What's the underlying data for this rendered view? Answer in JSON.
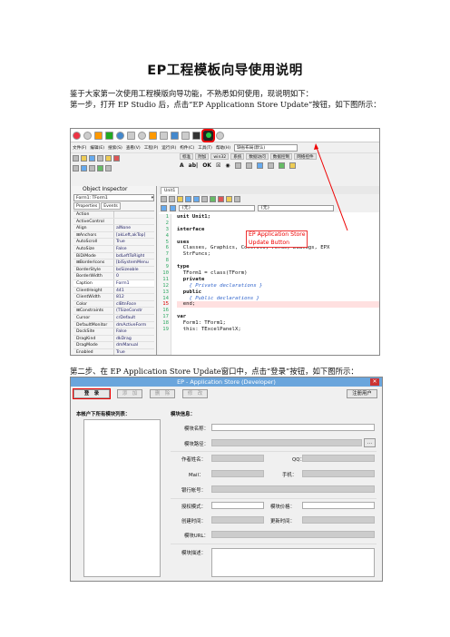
{
  "title": "EP工程模板向导使用说明",
  "intro": "鉴于大家第一次使用工程模版向导功能，不熟悉如何使用，现说明如下：",
  "step1": "第一步，打开 EP Studio 后，点击“EP Applicationn Store Update”按钮，如下图所示：",
  "step2": "第二步、在 EP Application Store Update窗口中，点击“登录”按钮，如下图所示：",
  "ide": {
    "menu": [
      "文件(F)",
      "编辑(E)",
      "搜索(S)",
      "查看(V)",
      "工程(P)",
      "运行(R)",
      "构件(C)",
      "工具(T)",
      "帮助(H)"
    ],
    "layout_combo": "缺省布局(默认)",
    "palette_tabs": [
      "标准",
      "附加",
      "win32",
      "系统",
      "数据访问",
      "数据控制",
      "网络控件"
    ],
    "palette_glyphs": [
      "A",
      "ab|",
      "OK",
      "☒",
      "◉"
    ],
    "object_inspector": {
      "title": "Object Inspector",
      "combo": "Form1: TForm1",
      "tabs": [
        "Properties",
        "Events"
      ],
      "rows": [
        {
          "k": "Action",
          "v": ""
        },
        {
          "k": "ActiveControl",
          "v": ""
        },
        {
          "k": "Align",
          "v": "alNone"
        },
        {
          "k": "⊞Anchors",
          "v": "[akLeft,akTop]"
        },
        {
          "k": "AutoScroll",
          "v": "True"
        },
        {
          "k": "AutoSize",
          "v": "False"
        },
        {
          "k": "BiDiMode",
          "v": "bdLeftToRight"
        },
        {
          "k": "⊞BorderIcons",
          "v": "[biSystemMenu"
        },
        {
          "k": "BorderStyle",
          "v": "bsSizeable"
        },
        {
          "k": "BorderWidth",
          "v": "0"
        },
        {
          "k": "Caption",
          "v": "Form1"
        },
        {
          "k": "ClientHeight",
          "v": "441"
        },
        {
          "k": "ClientWidth",
          "v": "812"
        },
        {
          "k": "Color",
          "v": "clBtnFace"
        },
        {
          "k": "⊞Constraints",
          "v": "(TSizeConstr"
        },
        {
          "k": "Cursor",
          "v": "crDefault"
        },
        {
          "k": "DefaultMonitor",
          "v": "dmActiveForm"
        },
        {
          "k": "DockSite",
          "v": "False"
        },
        {
          "k": "DragKind",
          "v": "dkDrag"
        },
        {
          "k": "DragMode",
          "v": "dmManual"
        },
        {
          "k": "Enabled",
          "v": "True"
        }
      ]
    },
    "editor": {
      "tab": "Unit1",
      "nav_left": "{无}",
      "nav_right": "{无}",
      "lines": [
        "unit Unit1;",
        "",
        "interface",
        "",
        "uses",
        "  Classes, Graphics, Controls, Forms, Dialogs, EPX",
        "  StrFuncs;",
        "",
        "type",
        "  TForm1 = class(TForm)",
        "  private",
        "    { Private declarations }",
        "  public",
        "    { Public declarations }",
        "  end;",
        "",
        "var",
        "  Form1: TForm1;",
        "  this: TExcelPanelX;"
      ],
      "line_numbers": [
        "1",
        "2",
        "3",
        "4",
        "5",
        "6",
        "7",
        "8",
        "9",
        "10",
        "11",
        "12",
        "13",
        "14",
        "15",
        "16",
        "17",
        "18",
        "19"
      ]
    },
    "callout_line1": "EP Application Store",
    "callout_line2": "Update  Button"
  },
  "store": {
    "title": "EP - Application Store (Developer)",
    "close": "✕",
    "buttons": {
      "login": "登　录",
      "add": "添　加",
      "delete": "删　除",
      "modify": "修　改",
      "register": "注册用户"
    },
    "left_label": "本帐户下所有模块列表：",
    "right_label": "模块信息：",
    "fields": {
      "name": "模块名称：",
      "path": "模块路径：",
      "author": "作者姓名：",
      "qq": "QQ：",
      "mail": "Mail：",
      "phone": "手机：",
      "bank": "银行帐号：",
      "license": "授权模式：",
      "price": "模块价格：",
      "created": "创建时间：",
      "updated": "更新时间：",
      "url": "模块URL：",
      "desc": "模块描述：",
      "browse": "..."
    }
  }
}
